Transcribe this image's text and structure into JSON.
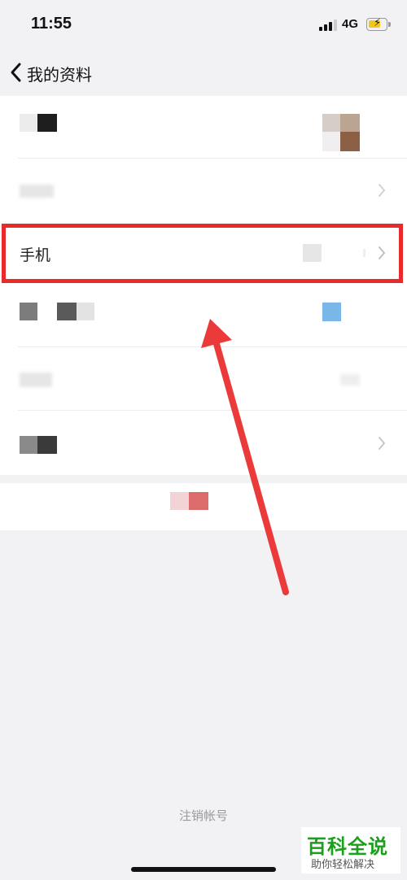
{
  "status_bar": {
    "time": "11:55",
    "network": "4G",
    "battery_icon": "battery-charging-icon",
    "signal_icon": "cellular-signal-icon"
  },
  "nav": {
    "back_icon": "chevron-left-icon",
    "title": "我的资料"
  },
  "profile_rows": {
    "phone_label": "手机"
  },
  "footer": {
    "cancel_account": "注销帐号"
  },
  "watermark": {
    "title": "百科全说",
    "subtitle": "助你轻松解决"
  },
  "colors": {
    "highlight": "#e82a2a",
    "watermark_green": "#1aa01a",
    "background": "#f2f2f5"
  }
}
